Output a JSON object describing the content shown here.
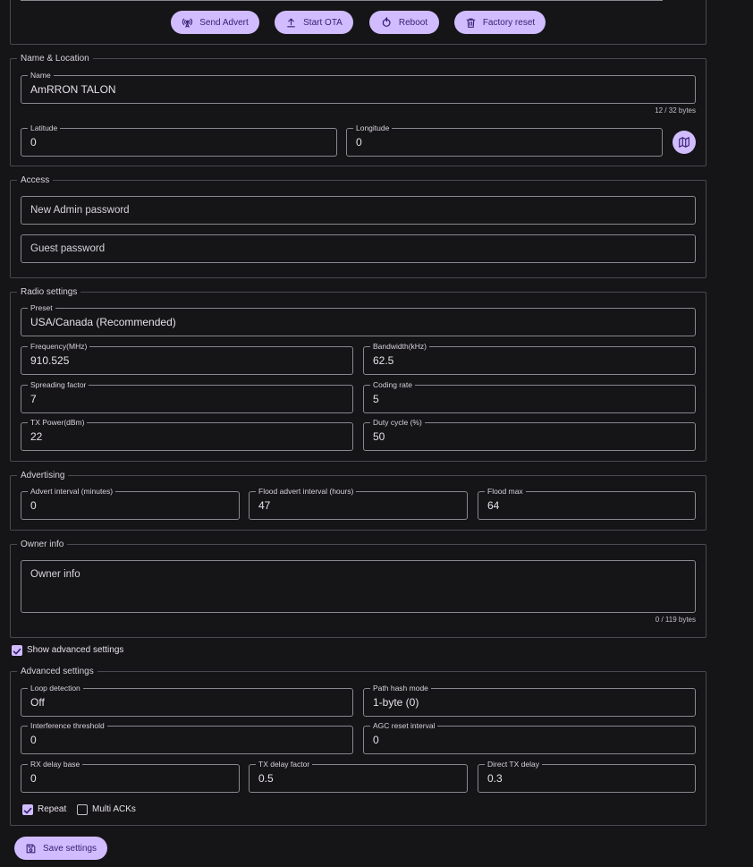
{
  "actions": {
    "send_advert": "Send Advert",
    "start_ota": "Start OTA",
    "reboot": "Reboot",
    "factory_reset": "Factory reset"
  },
  "name_location": {
    "legend": "Name & Location",
    "name_label": "Name",
    "name_value": "AmRRON TALON",
    "name_counter": "12 / 32 bytes",
    "latitude_label": "Latitude",
    "latitude_value": "0",
    "longitude_label": "Longitude",
    "longitude_value": "0",
    "map_icon": "map-icon"
  },
  "access": {
    "legend": "Access",
    "admin_placeholder": "New Admin password",
    "guest_placeholder": "Guest password"
  },
  "radio": {
    "legend": "Radio settings",
    "preset_label": "Preset",
    "preset_value": "USA/Canada (Recommended)",
    "frequency_label": "Frequency(MHz)",
    "frequency_value": "910.525",
    "bandwidth_label": "Bandwidth(kHz)",
    "bandwidth_value": "62.5",
    "spreading_label": "Spreading factor",
    "spreading_value": "7",
    "coding_label": "Coding rate",
    "coding_value": "5",
    "txpower_label": "TX Power(dBm)",
    "txpower_value": "22",
    "duty_label": "Duty cycle (%)",
    "duty_value": "50"
  },
  "advertising": {
    "legend": "Advertising",
    "advert_interval_label": "Advert interval (minutes)",
    "advert_interval_value": "0",
    "flood_interval_label": "Flood advert interval (hours)",
    "flood_interval_value": "47",
    "flood_max_label": "Flood max",
    "flood_max_value": "64"
  },
  "owner": {
    "legend": "Owner info",
    "placeholder": "Owner info",
    "counter": "0 / 119 bytes"
  },
  "show_advanced": {
    "label": "Show advanced settings",
    "checked": true
  },
  "advanced": {
    "legend": "Advanced settings",
    "loop_label": "Loop detection",
    "loop_value": "Off",
    "path_hash_label": "Path hash mode",
    "path_hash_value": "1-byte (0)",
    "interference_label": "Interference threshold",
    "interference_value": "0",
    "agc_label": "AGC reset interval",
    "agc_value": "0",
    "rx_delay_label": "RX delay base",
    "rx_delay_value": "0",
    "tx_delay_label": "TX delay factor",
    "tx_delay_value": "0.5",
    "direct_tx_label": "Direct TX delay",
    "direct_tx_value": "0.3",
    "repeat_label": "Repeat",
    "repeat_checked": true,
    "multi_acks_label": "Multi ACKs",
    "multi_acks_checked": false
  },
  "save_button": "Save settings",
  "colors": {
    "background": "#151417",
    "accent": "#d0bcff",
    "on_accent": "#381e72",
    "border": "#8a8790"
  }
}
